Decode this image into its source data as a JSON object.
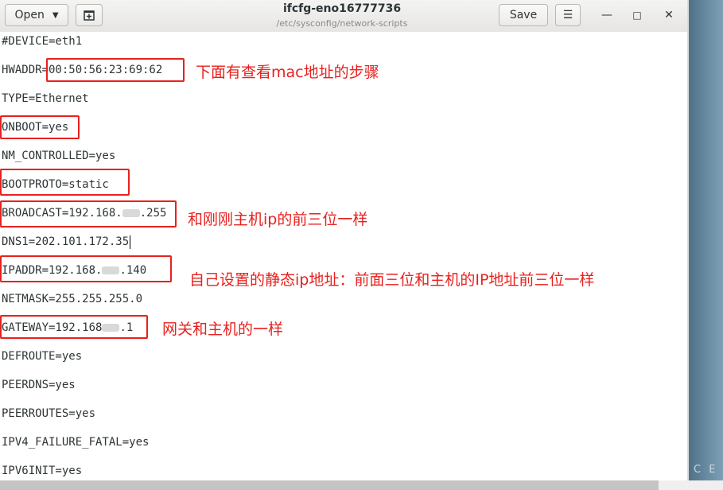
{
  "header": {
    "open_label": "Open",
    "open_caret": "▼",
    "new_tab_icon": "new-document-icon",
    "title": "ifcfg-eno16777736",
    "subtitle": "/etc/sysconfig/network-scripts",
    "save_label": "Save",
    "menu_icon": "☰",
    "minimize_icon": "—",
    "maximize_icon": "□",
    "close_icon": "✕"
  },
  "editor": {
    "lines": [
      "#DEVICE=eth1",
      "HWADDR=00:50:56:23:69:62",
      "TYPE=Ethernet",
      "ONBOOT=yes",
      "NM_CONTROLLED=yes",
      "BOOTPROTO=static",
      "BROADCAST=192.168.",
      ".255",
      "DNS1=202.101.172.35",
      "NETMASK=255.255.255.0",
      "IPADDR=192.168.",
      ".140",
      "GATEWAY=192.168",
      ".1",
      "DEFROUTE=yes",
      "PEERDNS=yes",
      "PEERROUTES=yes",
      "IPV4_FAILURE_FATAL=yes",
      "IPV6INIT=yes"
    ]
  },
  "annotations": {
    "mac": "下面有查看mac地址的步骤",
    "broadcast": "和刚刚主机ip的前三位一样",
    "ipaddr": "自己设置的静态ip地址：前面三位和主机的IP地址前三位一样",
    "gateway": "网关和主机的一样"
  },
  "desktop": {
    "edge_text": "C E"
  },
  "colors": {
    "annotation_red": "#e8211e",
    "header_bg": "#ebeae8",
    "text": "#2e3436"
  }
}
